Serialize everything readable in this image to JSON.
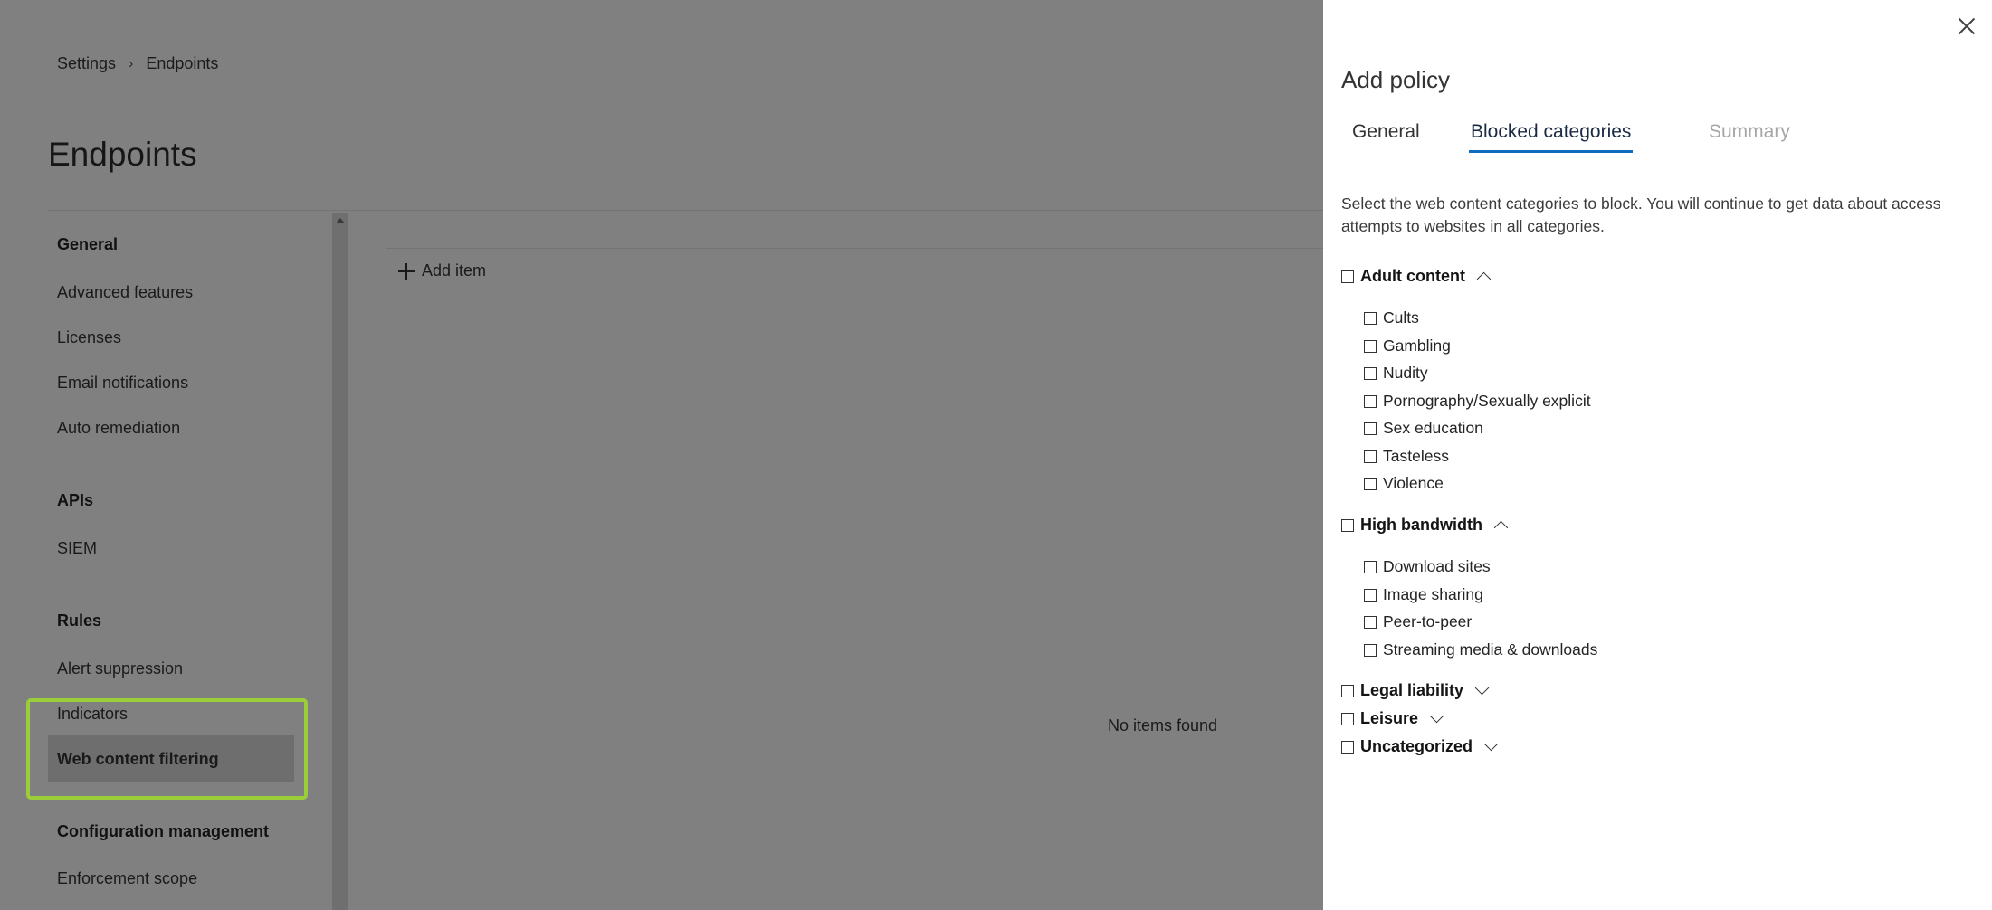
{
  "breadcrumb": {
    "root": "Settings",
    "current": "Endpoints"
  },
  "page": {
    "title": "Endpoints"
  },
  "sidebar": {
    "general": {
      "heading": "General",
      "items": [
        "Advanced features",
        "Licenses",
        "Email notifications",
        "Auto remediation"
      ]
    },
    "apis": {
      "heading": "APIs",
      "items": [
        "SIEM"
      ]
    },
    "rules": {
      "heading": "Rules",
      "items": [
        "Alert suppression",
        "Indicators",
        "Web content filtering"
      ]
    },
    "config": {
      "heading": "Configuration management",
      "items": [
        "Enforcement scope"
      ]
    },
    "selected": "Web content filtering"
  },
  "content": {
    "add_item": "Add item",
    "empty": "No items found"
  },
  "panel": {
    "title": "Add policy",
    "tabs": [
      {
        "label": "General",
        "state": "normal"
      },
      {
        "label": "Blocked categories",
        "state": "active"
      },
      {
        "label": "Summary",
        "state": "disabled"
      }
    ],
    "description": "Select the web content categories to block. You will continue to get data about access attempts to websites in all categories.",
    "groups": {
      "adult": {
        "label": "Adult content",
        "expanded": true,
        "items": [
          "Cults",
          "Gambling",
          "Nudity",
          "Pornography/Sexually explicit",
          "Sex education",
          "Tasteless",
          "Violence"
        ]
      },
      "bandwidth": {
        "label": "High bandwidth",
        "expanded": true,
        "items": [
          "Download sites",
          "Image sharing",
          "Peer-to-peer",
          "Streaming media & downloads"
        ]
      },
      "legal": {
        "label": "Legal liability",
        "expanded": false
      },
      "leisure": {
        "label": "Leisure",
        "expanded": false
      },
      "uncategorized": {
        "label": "Uncategorized",
        "expanded": false
      }
    }
  },
  "colors": {
    "accent": "#0f6cbd",
    "highlight": "#9bcc3a",
    "overlay": "#808080"
  }
}
